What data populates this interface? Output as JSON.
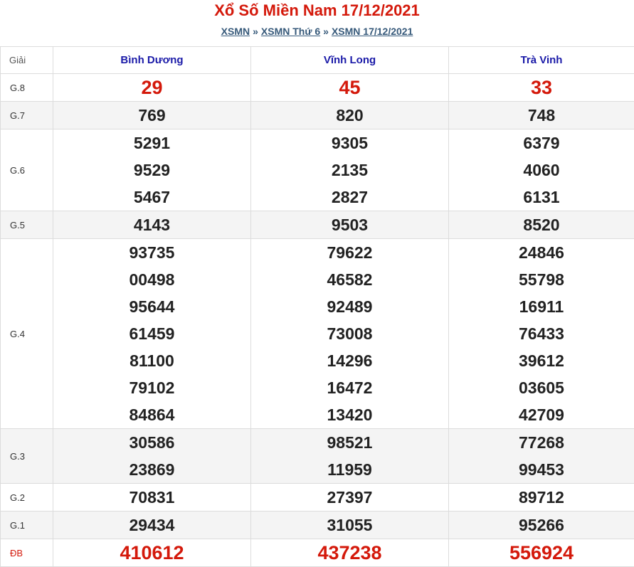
{
  "title": "Xổ Số Miền Nam 17/12/2021",
  "breadcrumb": {
    "items": [
      "XSMN",
      "XSMN Thứ 6",
      "XSMN 17/12/2021"
    ],
    "separator": "»"
  },
  "table": {
    "header": {
      "giai": "Giải",
      "provinces": [
        "Bình Dương",
        "Vĩnh Long",
        "Trà Vinh"
      ]
    },
    "rows": [
      {
        "label": "G.8",
        "values": [
          [
            "29"
          ],
          [
            "45"
          ],
          [
            "33"
          ]
        ]
      },
      {
        "label": "G.7",
        "values": [
          [
            "769"
          ],
          [
            "820"
          ],
          [
            "748"
          ]
        ]
      },
      {
        "label": "G.6",
        "values": [
          [
            "5291",
            "9529",
            "5467"
          ],
          [
            "9305",
            "2135",
            "2827"
          ],
          [
            "6379",
            "4060",
            "6131"
          ]
        ]
      },
      {
        "label": "G.5",
        "values": [
          [
            "4143"
          ],
          [
            "9503"
          ],
          [
            "8520"
          ]
        ]
      },
      {
        "label": "G.4",
        "values": [
          [
            "93735",
            "00498",
            "95644",
            "61459",
            "81100",
            "79102",
            "84864"
          ],
          [
            "79622",
            "46582",
            "92489",
            "73008",
            "14296",
            "16472",
            "13420"
          ],
          [
            "24846",
            "55798",
            "16911",
            "76433",
            "39612",
            "03605",
            "42709"
          ]
        ]
      },
      {
        "label": "G.3",
        "values": [
          [
            "30586",
            "23869"
          ],
          [
            "98521",
            "11959"
          ],
          [
            "77268",
            "99453"
          ]
        ]
      },
      {
        "label": "G.2",
        "values": [
          [
            "70831"
          ],
          [
            "27397"
          ],
          [
            "89712"
          ]
        ]
      },
      {
        "label": "G.1",
        "values": [
          [
            "29434"
          ],
          [
            "31055"
          ],
          [
            "95266"
          ]
        ]
      },
      {
        "label": "ĐB",
        "values": [
          [
            "410612"
          ],
          [
            "437238"
          ],
          [
            "556924"
          ]
        ]
      }
    ]
  },
  "colors": {
    "accent_red": "#d4190b",
    "header_blue": "#1a1aa8",
    "link_blue": "#36597a",
    "row_alt": "#f4f4f4"
  }
}
